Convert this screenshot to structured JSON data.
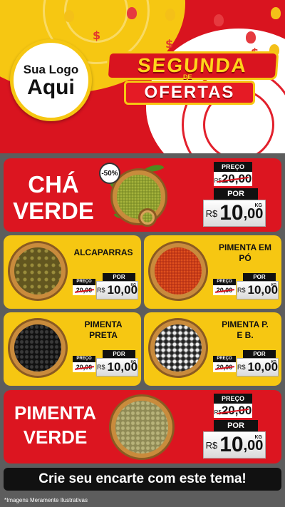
{
  "header": {
    "logo_line1": "Sua Logo",
    "logo_line2": "Aqui",
    "title_top": "SEGUNDA",
    "title_de": "DE",
    "title_bottom": "OFERTAS"
  },
  "labels": {
    "preco": "PREÇO",
    "por": "POR",
    "currency": "R$",
    "unit": "KG"
  },
  "products": {
    "cha_verde": {
      "name_line1": "CHÁ",
      "name_line2": "VERDE",
      "discount": "-50%",
      "old_price": "20,00",
      "price_int": "10",
      "price_dec": ",00"
    },
    "alcaparras": {
      "name_line1": "ALCAPARRAS",
      "name_line2": "",
      "old_price": "20,00",
      "price": "10,00"
    },
    "pimenta_em_po": {
      "name_line1": "PIMENTA EM",
      "name_line2": "PÓ",
      "old_price": "20,00",
      "price": "10,00"
    },
    "pimenta_preta": {
      "name_line1": "PIMENTA",
      "name_line2": "PRETA",
      "old_price": "20,00",
      "price": "10,00"
    },
    "pimenta_pb": {
      "name_line1": "PIMENTA P.",
      "name_line2": "E B.",
      "old_price": "20,00",
      "price": "10,00"
    },
    "pimenta_verde": {
      "name_line1": "PIMENTA",
      "name_line2": "VERDE",
      "old_price": "20,00",
      "price_int": "10",
      "price_dec": ",00"
    }
  },
  "footer": {
    "cta": "Crie seu encarte com este tema!",
    "disclaimer": "*Imagens Meramente Ilustrativas"
  },
  "colors": {
    "red": "#dc1520",
    "yellow": "#f6c712",
    "black": "#111111"
  }
}
